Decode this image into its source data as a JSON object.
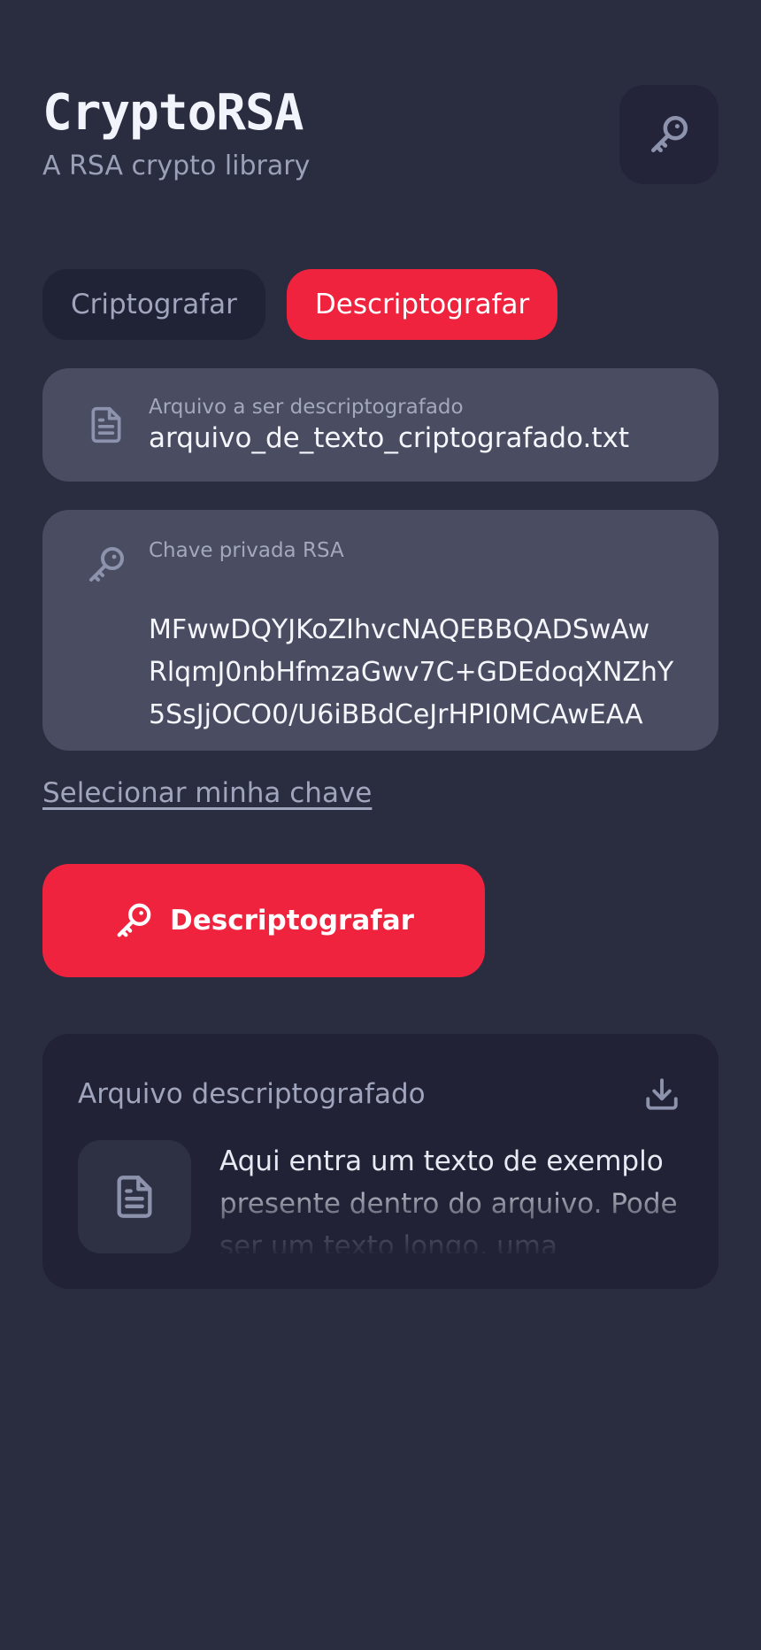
{
  "app": {
    "title": "CryptoRSA",
    "subtitle": "A RSA crypto library"
  },
  "header": {
    "key_button_icon": "key-icon"
  },
  "tabs": [
    {
      "label": "Criptografar",
      "active": false
    },
    {
      "label": "Descriptografar",
      "active": true
    }
  ],
  "file_input": {
    "icon": "file-text-icon",
    "label": "Arquivo a ser descriptografado",
    "value": "arquivo_de_texto_criptografado.txt"
  },
  "key_input": {
    "icon": "key-icon",
    "label": "Chave privada RSA",
    "value": "MFwwDQYJKoZIhvcNAQEBBQADSwAw\nRlqmJ0nbHfmzaGwv7C+GDEdoqXNZhY\n5SsJjOCO0/U6iBBdCeJrHPI0MCAwEAA"
  },
  "select_key_link": "Selecionar minha chave",
  "action_button": {
    "label": "Descriptografar",
    "icon": "key-icon"
  },
  "result": {
    "title": "Arquivo descriptografado",
    "download_icon": "download-icon",
    "file_icon": "file-text-icon",
    "preview": "Aqui entra um texto de exemplo presente dentro do arquivo. Pode ser um texto longo, uma"
  },
  "colors": {
    "background": "#2a2c3f",
    "accent": "#ef233e",
    "card": "#4a4c62",
    "card_dark": "#212235",
    "muted_text": "#a0a5bd"
  }
}
